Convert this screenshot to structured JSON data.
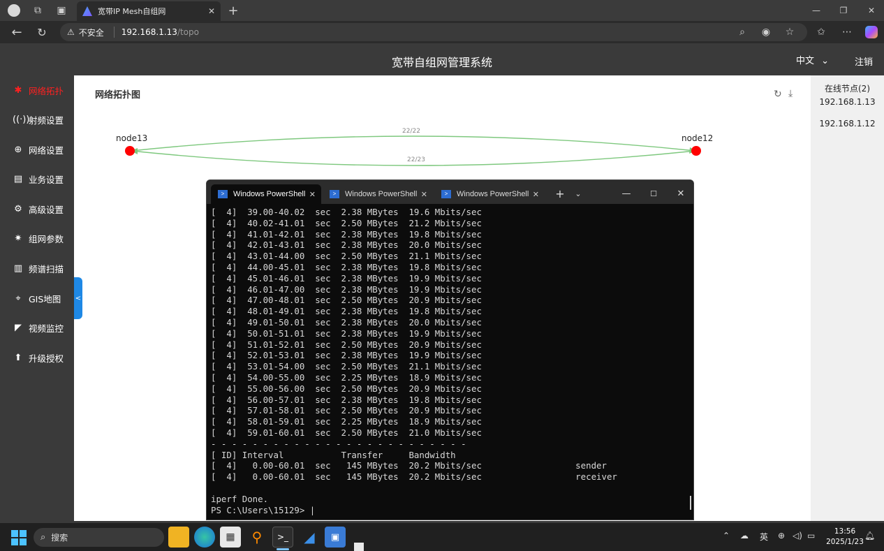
{
  "browser": {
    "tab_title": "宽带IP Mesh自组网",
    "security_label": "不安全",
    "url_host": "192.168.1.13",
    "url_path": "/topo"
  },
  "header": {
    "title": "宽带自组网管理系统",
    "language": "中文",
    "logout": "注销"
  },
  "sidebar": {
    "items": [
      {
        "label": "网络拓扑",
        "icon": "topology-icon",
        "active": true
      },
      {
        "label": "射频设置",
        "icon": "antenna-icon"
      },
      {
        "label": "网络设置",
        "icon": "globe-icon"
      },
      {
        "label": "业务设置",
        "icon": "document-icon"
      },
      {
        "label": "高级设置",
        "icon": "gear-icon"
      },
      {
        "label": "组网参数",
        "icon": "network-icon"
      },
      {
        "label": "频谱扫描",
        "icon": "spectrum-icon"
      },
      {
        "label": "GIS地图",
        "icon": "map-pin-icon"
      },
      {
        "label": "视频监控",
        "icon": "camera-icon"
      },
      {
        "label": "升级授权",
        "icon": "upgrade-icon"
      }
    ]
  },
  "main": {
    "title": "网络拓扑图",
    "topology": {
      "nodes": [
        {
          "name": "node13",
          "color": "#ff0000"
        },
        {
          "name": "node12",
          "color": "#ff0000"
        }
      ],
      "links": [
        {
          "label": "22/22",
          "color": "#7ec87e"
        },
        {
          "label": "22/23",
          "color": "#7ec87e"
        }
      ]
    }
  },
  "online": {
    "title": "在线节点(2)",
    "nodes": [
      "192.168.1.13",
      "192.168.1.12"
    ]
  },
  "terminal": {
    "tabs": [
      "Windows PowerShell",
      "Windows PowerShell",
      "Windows PowerShell"
    ],
    "lines": [
      "[  4]  39.00-40.02  sec  2.38 MBytes  19.6 Mbits/sec",
      "[  4]  40.02-41.01  sec  2.50 MBytes  21.2 Mbits/sec",
      "[  4]  41.01-42.01  sec  2.38 MBytes  19.8 Mbits/sec",
      "[  4]  42.01-43.01  sec  2.38 MBytes  20.0 Mbits/sec",
      "[  4]  43.01-44.00  sec  2.50 MBytes  21.1 Mbits/sec",
      "[  4]  44.00-45.01  sec  2.38 MBytes  19.8 Mbits/sec",
      "[  4]  45.01-46.01  sec  2.38 MBytes  19.9 Mbits/sec",
      "[  4]  46.01-47.00  sec  2.38 MBytes  19.9 Mbits/sec",
      "[  4]  47.00-48.01  sec  2.50 MBytes  20.9 Mbits/sec",
      "[  4]  48.01-49.01  sec  2.38 MBytes  19.8 Mbits/sec",
      "[  4]  49.01-50.01  sec  2.38 MBytes  20.0 Mbits/sec",
      "[  4]  50.01-51.01  sec  2.38 MBytes  19.9 Mbits/sec",
      "[  4]  51.01-52.01  sec  2.50 MBytes  20.9 Mbits/sec",
      "[  4]  52.01-53.01  sec  2.38 MBytes  19.9 Mbits/sec",
      "[  4]  53.01-54.00  sec  2.50 MBytes  21.1 Mbits/sec",
      "[  4]  54.00-55.00  sec  2.25 MBytes  18.9 Mbits/sec",
      "[  4]  55.00-56.00  sec  2.50 MBytes  20.9 Mbits/sec",
      "[  4]  56.00-57.01  sec  2.38 MBytes  19.8 Mbits/sec",
      "[  4]  57.01-58.01  sec  2.50 MBytes  20.9 Mbits/sec",
      "[  4]  58.01-59.01  sec  2.25 MBytes  18.9 Mbits/sec",
      "[  4]  59.01-60.01  sec  2.50 MBytes  21.0 Mbits/sec",
      "- - - - - - - - - - - - - - - - - - - - - - - - -",
      "[ ID] Interval           Transfer     Bandwidth",
      "[  4]   0.00-60.01  sec   145 MBytes  20.2 Mbits/sec                  sender",
      "[  4]   0.00-60.01  sec   145 MBytes  20.2 Mbits/sec                  receiver",
      "",
      "iperf Done.",
      "PS C:\\Users\\15129> |"
    ]
  },
  "taskbar": {
    "search_label": "搜索",
    "ime": "英",
    "time": "13:56",
    "date": "2025/1/23"
  }
}
